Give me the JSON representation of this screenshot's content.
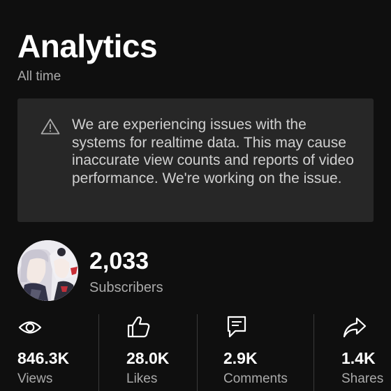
{
  "header": {
    "title": "Analytics",
    "period": "All time"
  },
  "notice": {
    "icon": "warning-icon",
    "message": "We are experiencing issues with the systems for realtime data. This may cause inaccurate view counts and reports of video performance. We're working on the issue."
  },
  "channel": {
    "subscriber_count": "2,033",
    "subscriber_label": "Subscribers"
  },
  "stats": [
    {
      "icon": "eye-icon",
      "value": "846.3K",
      "label": "Views"
    },
    {
      "icon": "thumbs-up-icon",
      "value": "28.0K",
      "label": "Likes"
    },
    {
      "icon": "comment-icon",
      "value": "2.9K",
      "label": "Comments"
    },
    {
      "icon": "share-icon",
      "value": "1.4K",
      "label": "Shares"
    }
  ],
  "colors": {
    "background": "#0f0f0f",
    "card": "#272727",
    "text_primary": "#ffffff",
    "text_secondary": "#aaaaaa"
  }
}
